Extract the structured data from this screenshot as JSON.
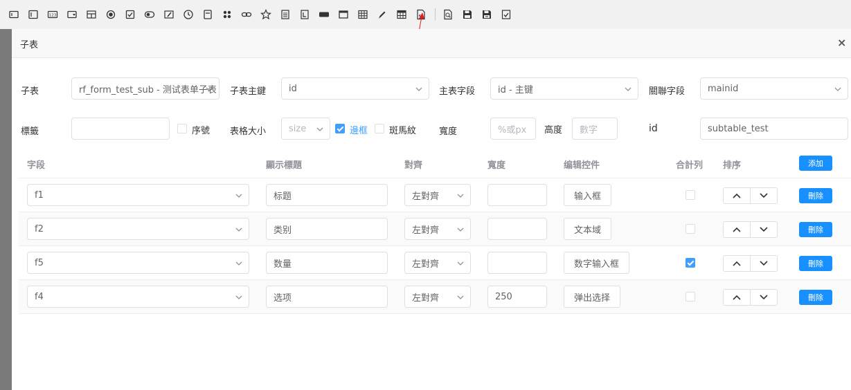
{
  "toolbar": {
    "icons": [
      "textbox-icon",
      "textarea-icon",
      "number-icon",
      "select-icon",
      "layout-icon",
      "radio-icon",
      "checkbox-icon",
      "switch-icon",
      "edit-icon",
      "clock-icon",
      "frame-icon",
      "grid-icon",
      "link-icon",
      "star-icon",
      "doc-icon",
      "label-icon",
      "bar-icon",
      "window-icon",
      "table-icon",
      "pencil-icon",
      "subtable-icon",
      "code-icon",
      "preview-icon",
      "save-icon",
      "save-as-icon",
      "check-icon"
    ]
  },
  "dialog": {
    "title": "子表",
    "close": "×"
  },
  "form": {
    "subtable_label": "子表",
    "subtable_value": "rf_form_test_sub - 测试表单子表",
    "subkey_label": "子表主鍵",
    "subkey_value": "id",
    "mainfield_label": "主表字段",
    "mainfield_value": "id - 主键",
    "relfield_label": "關聯字段",
    "relfield_value": "mainid",
    "tag_label": "標籤",
    "tag_value": "",
    "serial_label": "序號",
    "size_label": "表格大小",
    "size_placeholder": "size",
    "border_label": "邊框",
    "stripe_label": "斑馬紋",
    "width_label": "寬度",
    "width_placeholder": "%或px",
    "height_label": "高度",
    "height_placeholder": "數字",
    "id_label": "id",
    "id_value": "subtable_test"
  },
  "table": {
    "headers": {
      "field": "字段",
      "title": "顯示標題",
      "align": "對齊",
      "width": "寬度",
      "editor": "编辑控件",
      "sum": "合計列",
      "sort": "排序",
      "add": "添加"
    },
    "delete_label": "刪除",
    "rows": [
      {
        "field": "f1",
        "title": "标题",
        "align": "左對齊",
        "width": "",
        "editor": "输入框",
        "sum": false
      },
      {
        "field": "f2",
        "title": "类别",
        "align": "左對齊",
        "width": "",
        "editor": "文本域",
        "sum": false
      },
      {
        "field": "f5",
        "title": "数量",
        "align": "左對齊",
        "width": "",
        "editor": "数字输入框",
        "sum": true
      },
      {
        "field": "f4",
        "title": "选项",
        "align": "左對齊",
        "width": "250",
        "editor": "弹出选择",
        "sum": false
      }
    ]
  },
  "colors": {
    "primary": "#1890ff",
    "checkbox": "#409eff",
    "arrow": "#e02020"
  }
}
